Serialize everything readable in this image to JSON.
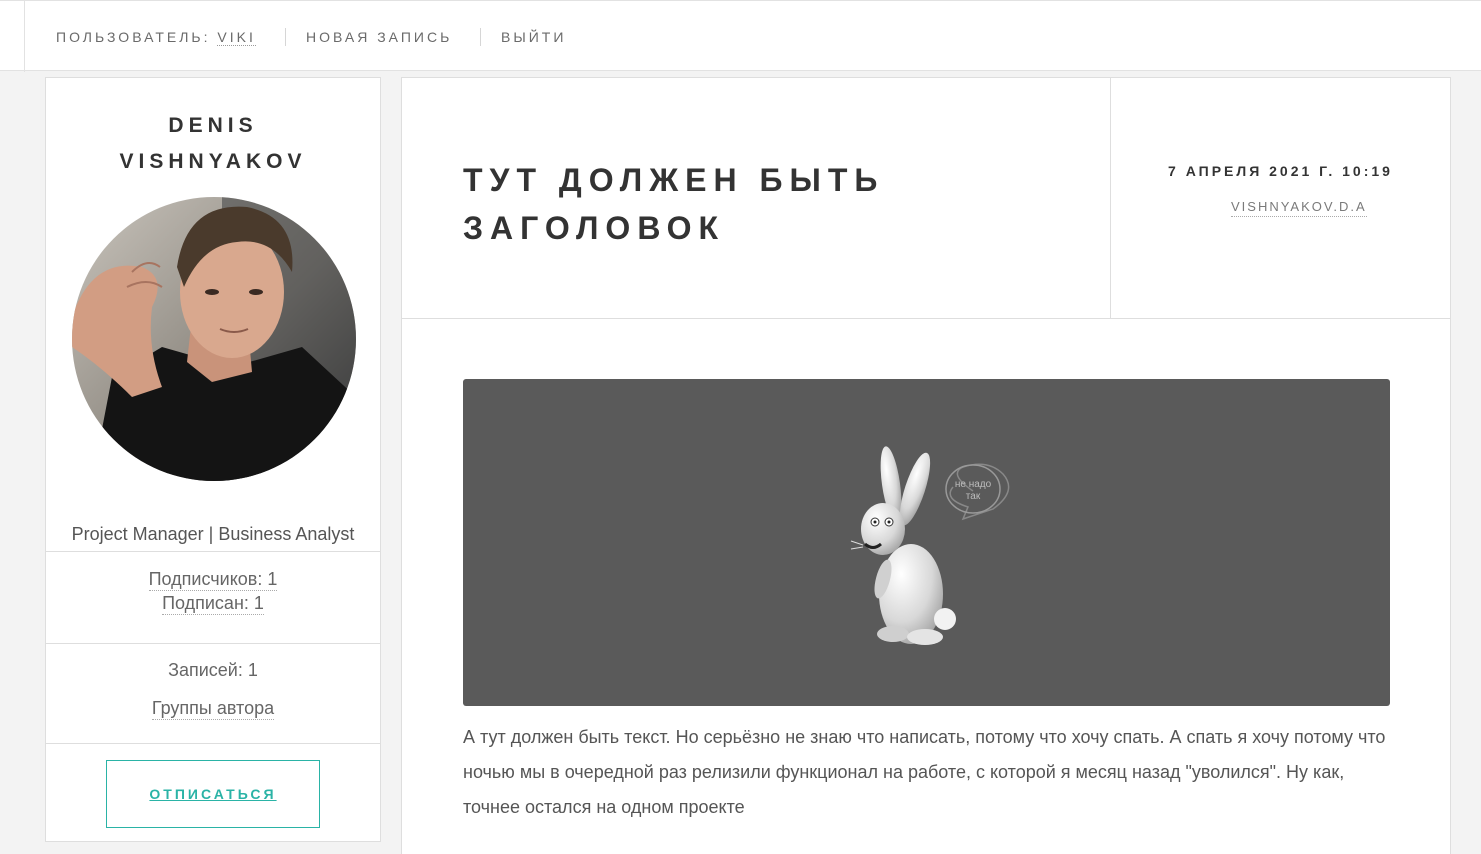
{
  "nav": {
    "user_prefix": "Пользователь:",
    "user_name": "viki",
    "new_post": "Новая запись",
    "logout": "Выйти"
  },
  "sidebar": {
    "name_line1": "Denis",
    "name_line2": "Vishnyakov",
    "role": "Project Manager | Business Analyst",
    "followers": "Подписчиков: 1",
    "following": "Подписан: 1",
    "posts": "Записей: 1",
    "groups": "Группы автора",
    "unsubscribe": "Отписаться"
  },
  "article": {
    "title": "Тут должен быть заголовок",
    "date": "7 апреля 2021 г. 10:19",
    "author": "vishnyakov.d.a",
    "image_bubble_line1": "не надо",
    "image_bubble_line2": "так",
    "body": "А тут должен быть текст. Но серьёзно не знаю что написать, потому что хочу спать. А спать я хочу потому что ночью мы в очередной раз релизили функционал на работе, с которой я месяц назад \"уволился\". Ну как, точнее остался на одном проекте"
  },
  "colors": {
    "accent": "#2ab3a6",
    "image_background": "#5a5a5a",
    "page_background": "#f3f3f3"
  }
}
